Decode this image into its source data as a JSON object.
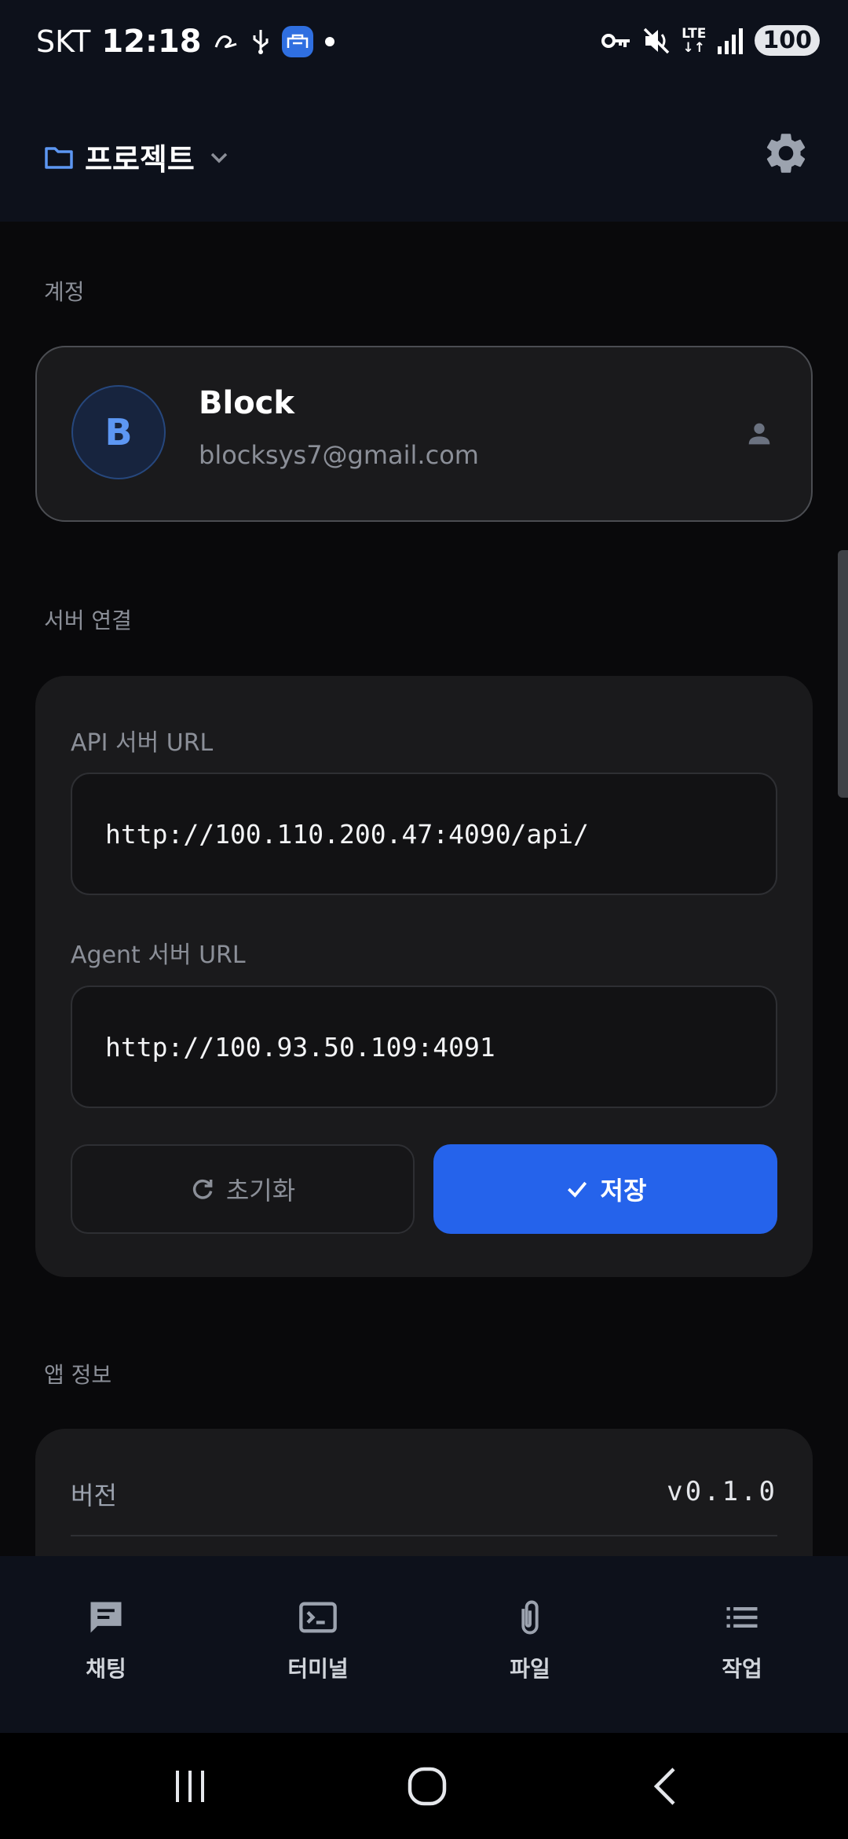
{
  "status_bar": {
    "carrier": "SKT",
    "time": "12:18",
    "network": "LTE",
    "battery": "100"
  },
  "header": {
    "project_label": "프로젝트"
  },
  "account": {
    "section_label": "계정",
    "avatar_initial": "B",
    "name": "Block",
    "email": "blocksys7@gmail.com"
  },
  "server": {
    "section_label": "서버 연결",
    "api_label": "API 서버 URL",
    "api_value": "http://100.110.200.47:4090/api/",
    "agent_label": "Agent 서버 URL",
    "agent_value": "http://100.93.50.109:4091",
    "reset_label": "초기화",
    "save_label": "저장"
  },
  "app_info": {
    "section_label": "앱 정보",
    "version_label": "버전",
    "version_value": "v0.1.0"
  },
  "bottom_nav": {
    "items": [
      {
        "label": "채팅",
        "icon": "chat-icon"
      },
      {
        "label": "터미널",
        "icon": "terminal-icon"
      },
      {
        "label": "파일",
        "icon": "paperclip-icon"
      },
      {
        "label": "작업",
        "icon": "list-icon"
      }
    ]
  },
  "colors": {
    "background": "#09090b",
    "card": "#1a1a1c",
    "accent": "#2563eb",
    "avatar_text": "#5d97f3"
  }
}
